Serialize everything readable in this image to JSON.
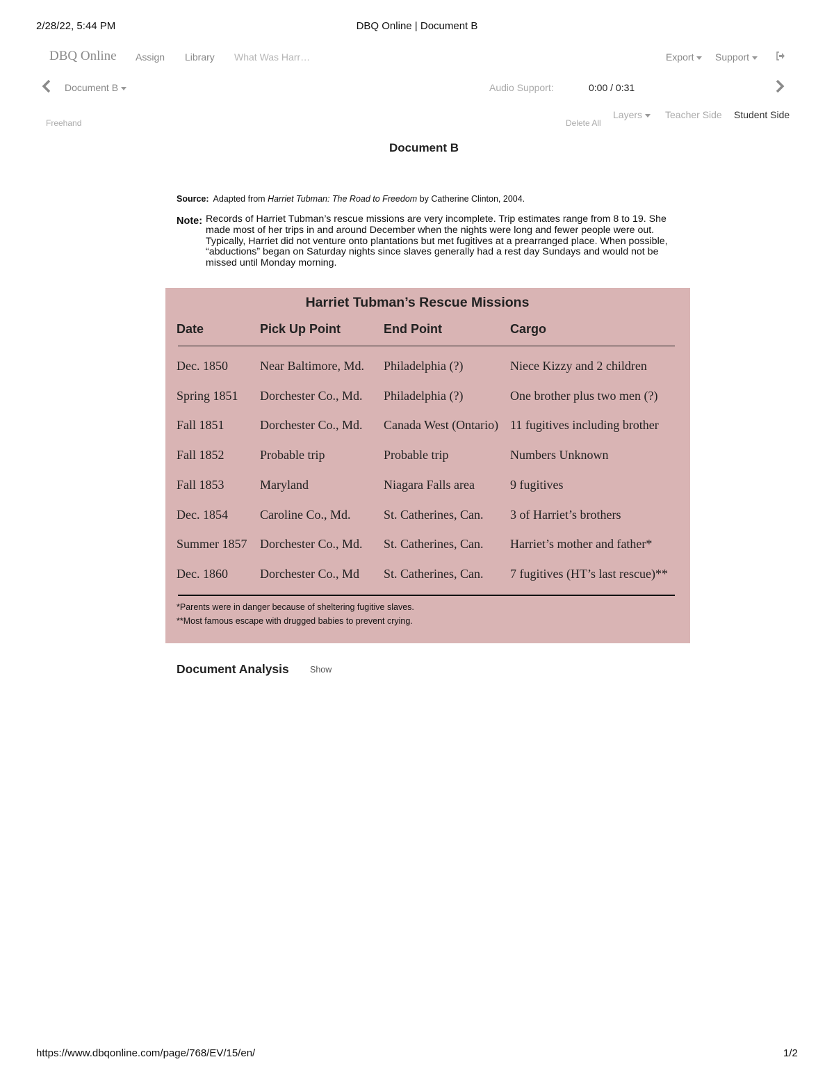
{
  "print_header": {
    "datetime": "2/28/22, 5:44 PM",
    "title": "DBQ Online | Document B"
  },
  "print_footer": {
    "url": "https://www.dbqonline.com/page/768/EV/15/en/",
    "page": "1/2"
  },
  "nav": {
    "brand": "DBQ Online",
    "links": [
      {
        "label": "Assign"
      },
      {
        "label": "Library"
      },
      {
        "label": "What Was Harr…"
      }
    ],
    "export_label": "Export",
    "support_label": "Support",
    "logout_icon": "sign-out-icon"
  },
  "doc_nav": {
    "prev_icon": "chevron-left-icon",
    "next_icon": "chevron-right-icon",
    "document_selector": "Document B",
    "audio_label": "Audio Support:",
    "audio_time": "0:00 / 0:31"
  },
  "toolbar": {
    "freehand": "Freehand",
    "delete_all": "Delete All",
    "layers": "Layers",
    "teacher_side": "Teacher Side",
    "student_side": "Student Side"
  },
  "document": {
    "title": "Document B",
    "source_label": "Source:",
    "source_prefix": "Adapted from ",
    "source_book": "Harriet Tubman: The Road to Freedom",
    "source_suffix": " by Catherine Clinton, 2004.",
    "note_label": "Note:",
    "note_text": "Records of Harriet Tubman’s rescue missions are very incomplete. Trip estimates range from 8 to 19. She made most of her trips in and around December when the nights were long and fewer people were out. Typically, Harriet did not venture onto plantations but met fugitives at a prearranged place. When possible, “abductions” began on Saturday nights since slaves generally had a rest day Sundays and would not be missed until Monday morning."
  },
  "table": {
    "title": "Harriet Tubman’s Rescue Missions",
    "background": "#d9b4b4",
    "headers": [
      "Date",
      "Pick Up Point",
      "End Point",
      "Cargo"
    ],
    "rows": [
      [
        "Dec. 1850",
        "Near Baltimore, Md.",
        "Philadelphia (?)",
        "Niece Kizzy and 2 children"
      ],
      [
        "Spring 1851",
        "Dorchester Co., Md.",
        "Philadelphia (?)",
        "One brother plus two men (?)"
      ],
      [
        "Fall 1851",
        "Dorchester Co., Md.",
        "Canada West (Ontario)",
        "11 fugitives including brother"
      ],
      [
        "Fall 1852",
        "Probable trip",
        "Probable trip",
        "Numbers Unknown"
      ],
      [
        "Fall 1853",
        "Maryland",
        "Niagara Falls area",
        "9 fugitives"
      ],
      [
        "Dec. 1854",
        "Caroline Co., Md.",
        "St. Catherines, Can.",
        "3 of Harriet’s brothers"
      ],
      [
        "Summer 1857",
        "Dorchester Co., Md.",
        "St. Catherines, Can.",
        "Harriet’s mother and father*"
      ],
      [
        "Dec. 1860",
        "Dorchester Co., Md",
        "St. Catherines, Can.",
        "7 fugitives (HT’s last rescue)**"
      ]
    ],
    "footnotes": [
      "*Parents were in danger because of sheltering fugitive slaves.",
      "**Most famous escape with drugged babies to prevent crying."
    ]
  },
  "analysis": {
    "title": "Document Analysis",
    "toggle": "Show"
  }
}
